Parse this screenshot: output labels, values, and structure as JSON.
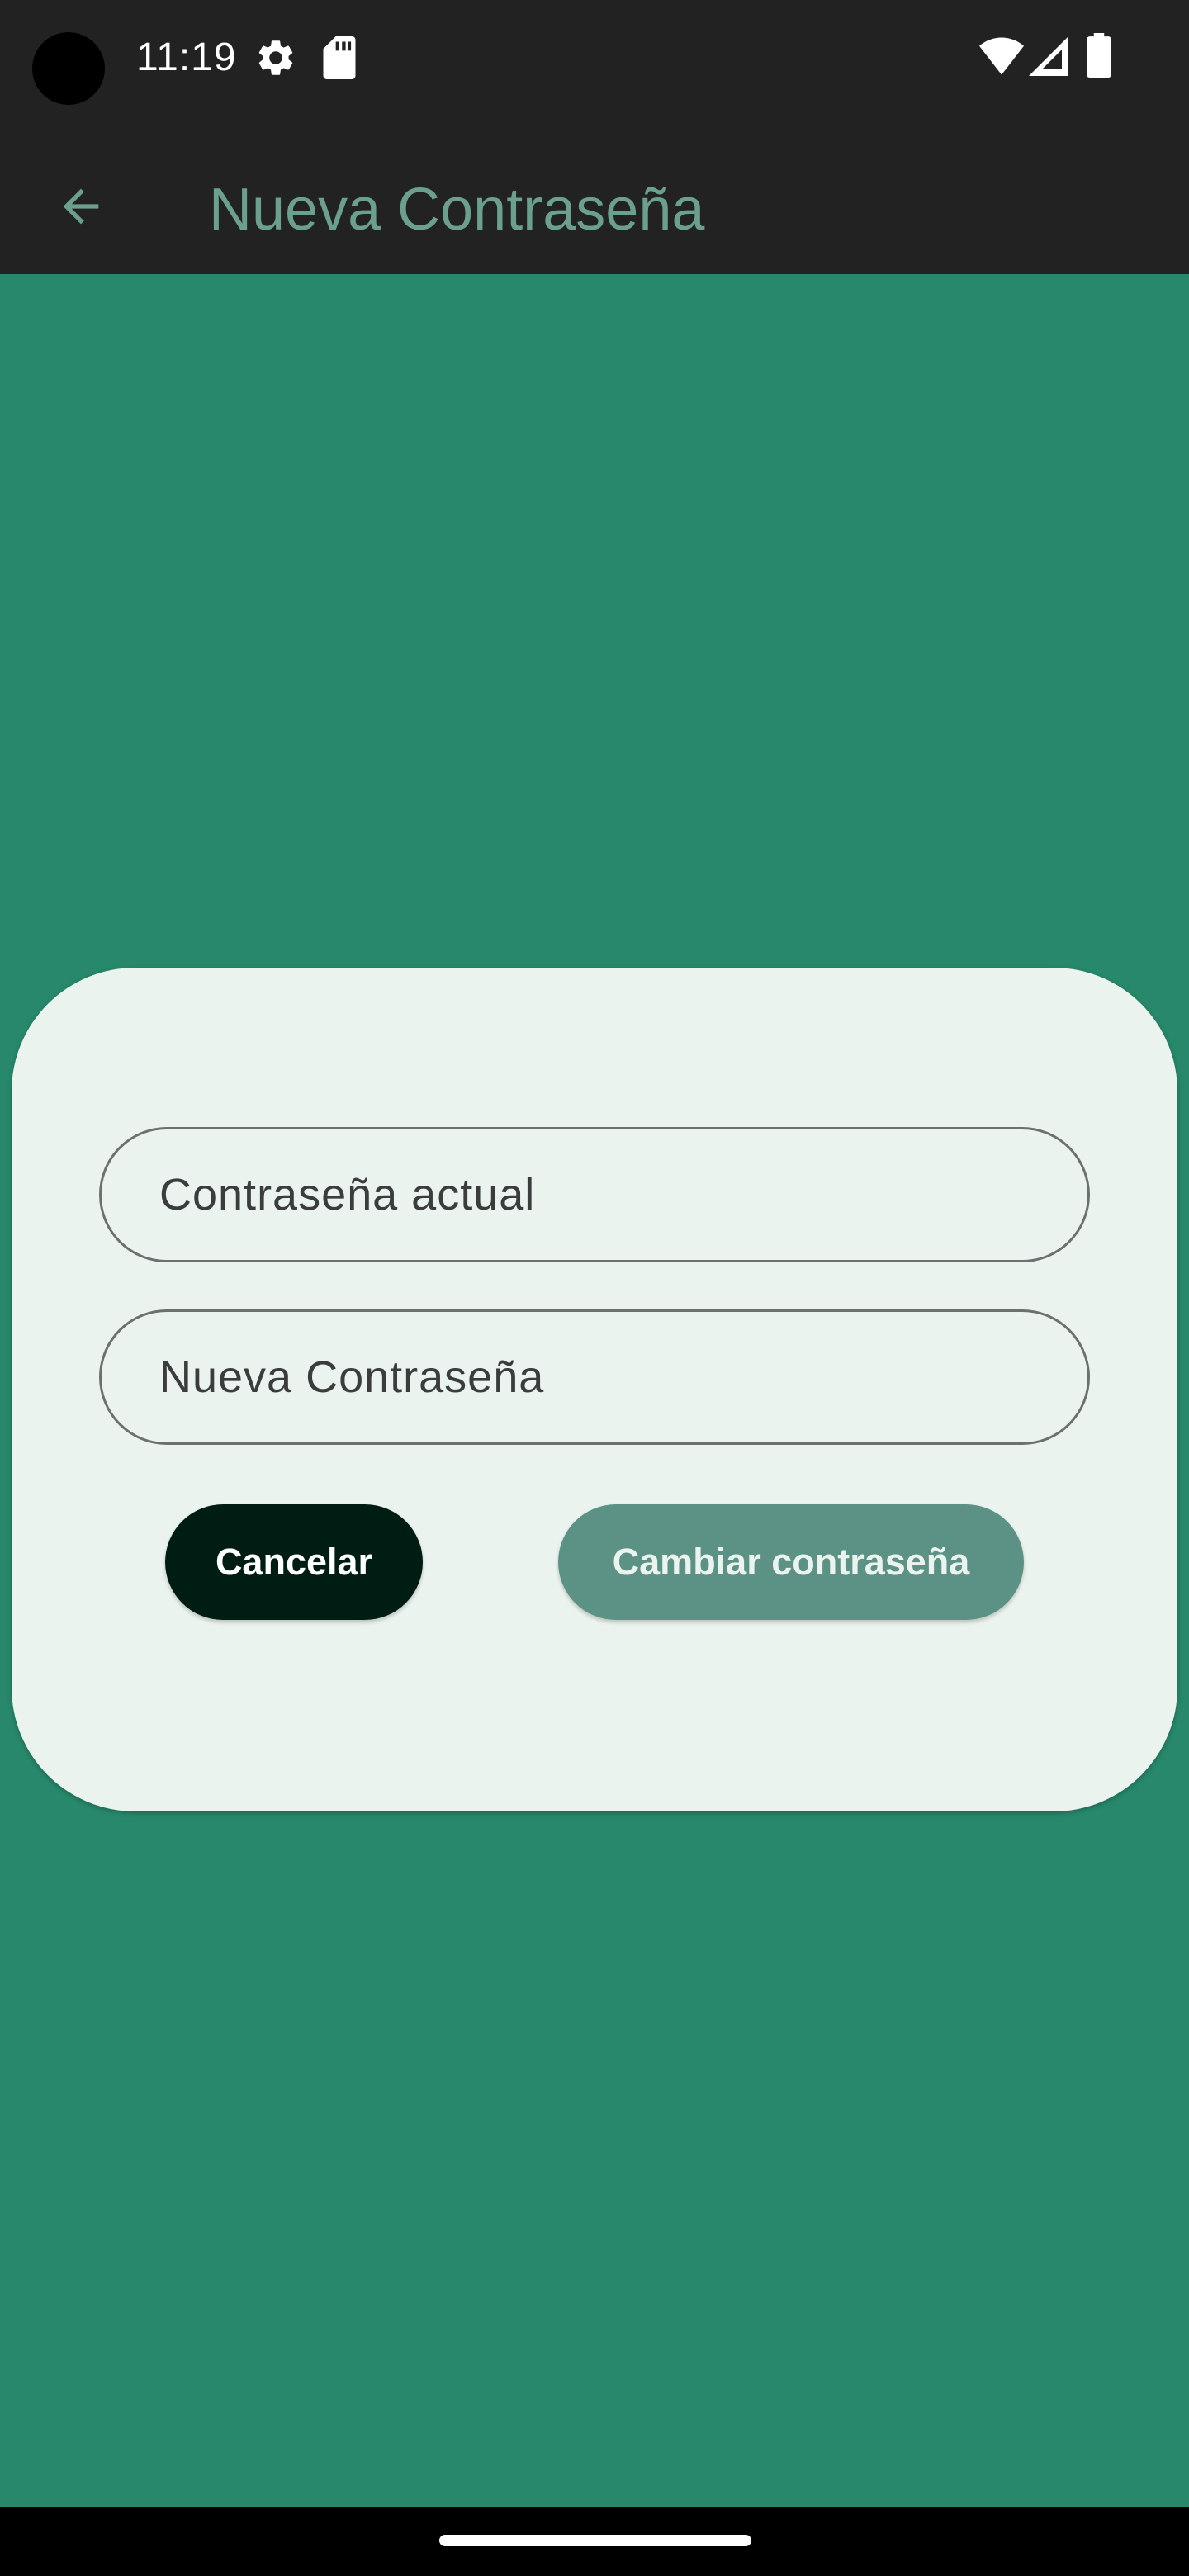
{
  "status_bar": {
    "time": "11:19",
    "icons": [
      "settings-gear-icon",
      "sd-card-icon",
      "wifi-icon",
      "cellular-signal-icon",
      "battery-icon"
    ]
  },
  "app_bar": {
    "title": "Nueva Contraseña",
    "back_icon": "arrow-back-icon",
    "title_color": "#6ba08e"
  },
  "dialog": {
    "current_password": {
      "placeholder": "Contraseña actual",
      "value": ""
    },
    "new_password": {
      "placeholder": "Nueva Contraseña",
      "value": ""
    },
    "cancel_label": "Cancelar",
    "change_label": "Cambiar contraseña"
  },
  "colors": {
    "background": "#27886b",
    "bars": "#222222",
    "card": "#ebf3ee",
    "cancel_button": "#001d13",
    "change_button": "#5c9285"
  }
}
